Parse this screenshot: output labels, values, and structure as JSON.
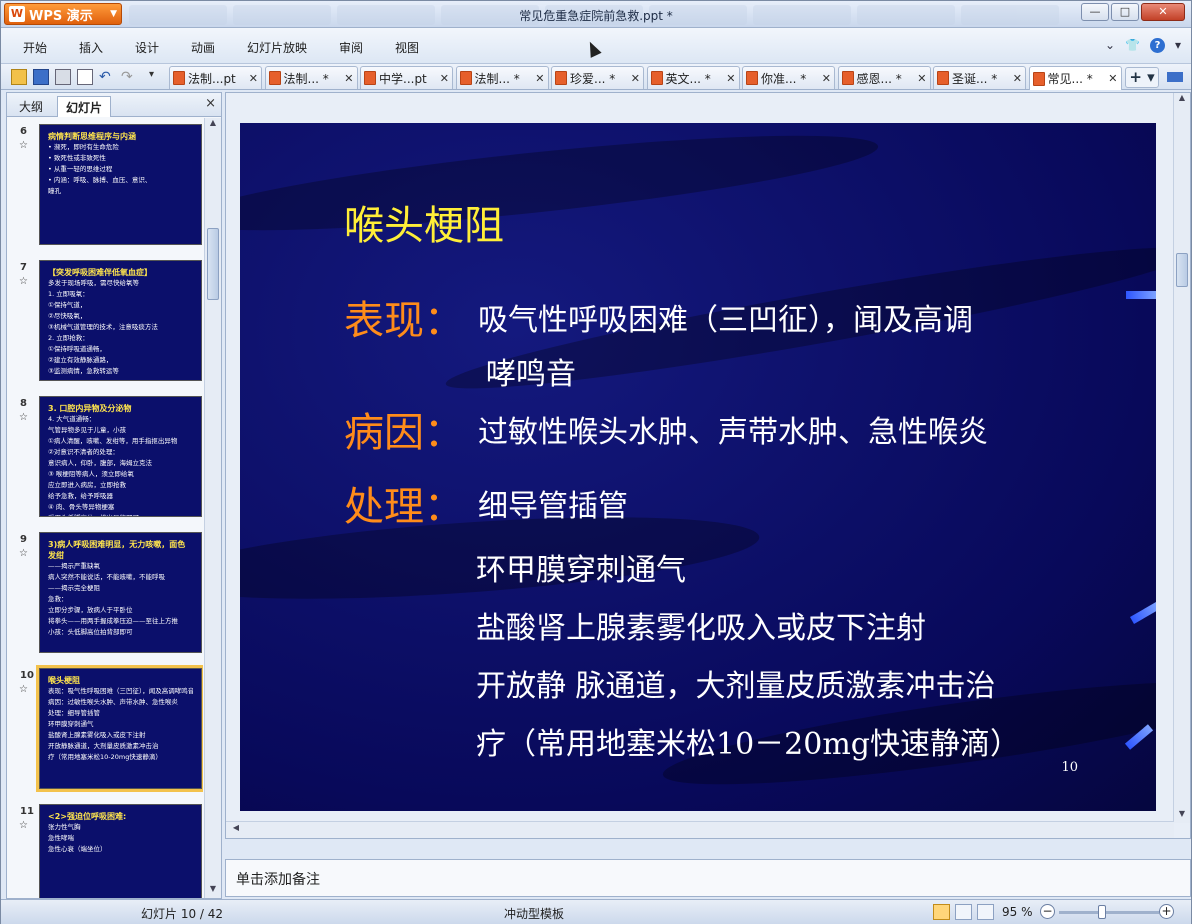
{
  "app": {
    "brand": "WPS 演示",
    "title": "常见危重急症院前急救.ppt *"
  },
  "window_controls": {
    "minimize": "—",
    "maximize": "□",
    "close": "✕"
  },
  "menu": [
    "开始",
    "插入",
    "设计",
    "动画",
    "幻灯片放映",
    "审阅",
    "视图"
  ],
  "doc_tabs": [
    {
      "label": "法制...pt",
      "active": false
    },
    {
      "label": "法制... *",
      "active": false
    },
    {
      "label": "中学...pt",
      "active": false
    },
    {
      "label": "法制... *",
      "active": false
    },
    {
      "label": "珍爱... *",
      "active": false
    },
    {
      "label": "英文... *",
      "active": false
    },
    {
      "label": "你准... *",
      "active": false
    },
    {
      "label": "感恩... *",
      "active": false
    },
    {
      "label": "圣诞... *",
      "active": false
    },
    {
      "label": "常见... *",
      "active": true
    }
  ],
  "pane": {
    "tab_outline": "大纲",
    "tab_slides": "幻灯片",
    "close": "×"
  },
  "thumbnails": [
    {
      "num": "6",
      "title": "病情判断思维程序与内涵",
      "lines": [
        "• 濒死，即时有生命危险",
        "• 致死性或非致死性",
        "• 从重一轻的思维过程",
        "• 内涵：呼吸、脉搏、血压、意识、",
        "  瞳孔"
      ]
    },
    {
      "num": "7",
      "title": "【突发呼吸困难伴低氧血症】",
      "lines": [
        "多发于现场呼吸，需尽快给氧等",
        "1. 立即吸氧：",
        "  ①保持气道，",
        "  ②尽快吸氧，",
        "  ③机械气道管理的技术，注意吸痰方法",
        "2. 立即抢救：",
        "  ①保持呼吸道通畅，",
        "  ②建立有效静脉通路，",
        "  ③监测病情，急救转运等"
      ]
    },
    {
      "num": "8",
      "title": "3. 口腔内异物及分泌物",
      "lines": [
        "4. 大气道通畅：",
        "  气管异物多见于儿童，小孩",
        "  ①病人清醒，咳嗽、发绀等，用手指抠出异物",
        "  ②对意识不清者的处理：",
        "  意识病人，仰卧，腹部，海姆立克法",
        "  ③ 喉梗阻等病人，须立即给氧",
        "  应立即进入病房，立即抢救",
        "  给予急救，给予呼吸器",
        "  ④ 肉、骨头等异物梗塞",
        "  采用头低脚高位，排出异物即可"
      ]
    },
    {
      "num": "9",
      "title": "3)病人呼吸困难明显，无力咳嗽，面色发绀",
      "lines": [
        "——揭示严重缺氧",
        "病人突然不能说话，不能咳嗽，不能呼吸",
        "——揭示完全梗阻",
        "急救：",
        "立即分步骤，放病人于平卧位",
        "将拳头——用两手握成拳压迫——至往上方推",
        "小孩：头低脚高位拍背部即可"
      ]
    },
    {
      "num": "10",
      "title": "喉头梗阻",
      "lines": [
        "表现：吸气性呼吸困难（三凹征），闻及高调哮鸣音",
        "病因：过敏性喉头水肿、声带水肿、急性喉炎",
        "处理：细导管插管",
        "  环甲膜穿刺通气",
        "  盐酸肾上腺素雾化吸入或皮下注射",
        "  开放静脉通道，大剂量皮质激素冲击治",
        "  疗（常用地塞米松10-20mg快速静滴）"
      ]
    },
    {
      "num": "11",
      "title": "<2>强迫位呼吸困难:",
      "lines": [
        "张力性气胸",
        "急性哮喘",
        "急性心衰（端坐位）"
      ]
    }
  ],
  "slide": {
    "title": "喉头梗阻",
    "items": [
      {
        "key": "表现：",
        "text": "吸气性呼吸困难（三凹征），闻及高调",
        "cont": "哮鸣音"
      },
      {
        "key": "病因：",
        "text": "过敏性喉头水肿、声带水肿、急性喉炎"
      },
      {
        "key": "处理：",
        "text": "细导管插管"
      }
    ],
    "lines": [
      "环甲膜穿刺通气",
      "盐酸肾上腺素雾化吸入或皮下注射",
      "开放静 脉通道，大剂量皮质激素冲击治",
      "疗（常用地塞米松10－20mg快速静滴）"
    ],
    "number": "10"
  },
  "notes": "单击添加备注",
  "status": {
    "slide_info": "幻灯片 10 / 42",
    "template": "冲动型模板",
    "zoom": "95 %"
  },
  "colors": {
    "slide_bg": "#0b0f6b",
    "title": "#ffee38",
    "key": "#ff8c1a",
    "accent": "#f3c24c"
  }
}
